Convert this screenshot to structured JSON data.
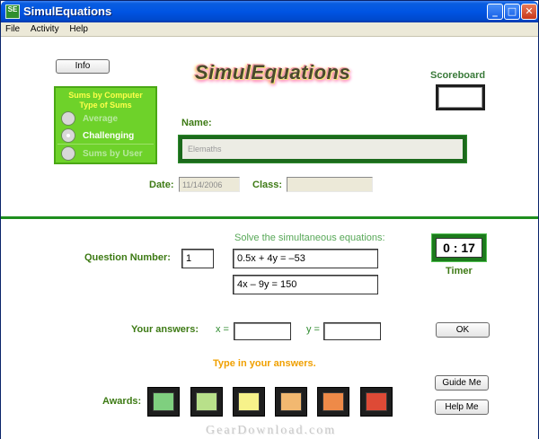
{
  "window": {
    "title": "SimulEquations",
    "icon_text": "SE",
    "minimize_symbol": "_",
    "maximize_symbol": "□",
    "close_symbol": "✕"
  },
  "menu": [
    "File",
    "Activity",
    "Help"
  ],
  "header": {
    "info_button": "Info",
    "logo_text": "SimulEquations",
    "scoreboard_label": "Scoreboard",
    "scoreboard_value": ""
  },
  "sum_type": {
    "title_line1": "Sums by Computer",
    "title_line2": "Type of Sums",
    "options": [
      {
        "label": "Average",
        "selected": false
      },
      {
        "label": "Challenging",
        "selected": true
      },
      {
        "label": "Sums by User",
        "selected": false
      }
    ]
  },
  "student": {
    "name_label": "Name:",
    "name_value": "Elemaths",
    "date_label": "Date:",
    "date_value": "11/14/2006",
    "class_label": "Class:",
    "class_value": ""
  },
  "question": {
    "instruction": "Solve the simultaneous equations:",
    "number_label": "Question Number:",
    "number_value": "1",
    "equation1": "0.5x + 4y = –53",
    "equation2": "4x – 9y = 150",
    "timer_value": "0 : 17",
    "timer_label": "Timer"
  },
  "answers": {
    "label": "Your answers:",
    "x_label": "x =",
    "x_value": "",
    "y_label": "y =",
    "y_value": "",
    "ok_button": "OK",
    "hint": "Type in your answers.",
    "guide_button": "Guide Me",
    "help_button": "Help Me"
  },
  "awards": {
    "label": "Awards:",
    "colors": [
      "#7fcf7f",
      "#b8e08a",
      "#f7f28a",
      "#f2b870",
      "#ee8a48",
      "#de4a36"
    ]
  },
  "watermark": "GearDownload.com",
  "colors": {
    "accent_green": "#2e8b2e",
    "panel_green": "#6ed22a",
    "hint_orange": "#f0a000",
    "instruction_green": "#58a858"
  }
}
